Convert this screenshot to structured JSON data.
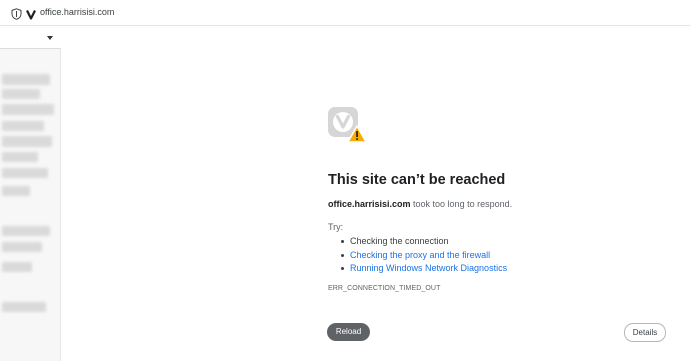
{
  "browser": {
    "url": "office.harrisisi.com",
    "security_icon": "shield-icon",
    "logo_icon": "vivaldi-logo-icon"
  },
  "sidepanel": {
    "dropdown_icon": "chevron-down-icon"
  },
  "error": {
    "icon": "vivaldi-warning-icon",
    "title": "This site can’t be reached",
    "host": "office.harrisisi.com",
    "message": " took too long to respond.",
    "try_label": "Try:",
    "suggestions": [
      "Checking the connection",
      "Checking the proxy and the firewall",
      "Running Windows Network Diagnostics"
    ],
    "code": "ERR_CONNECTION_TIMED_OUT"
  },
  "buttons": {
    "reload": "Reload",
    "details": "Details"
  },
  "colors": {
    "link": "#1a73e8",
    "reload_bg": "#5f6368",
    "warning": "#f9ab00"
  }
}
